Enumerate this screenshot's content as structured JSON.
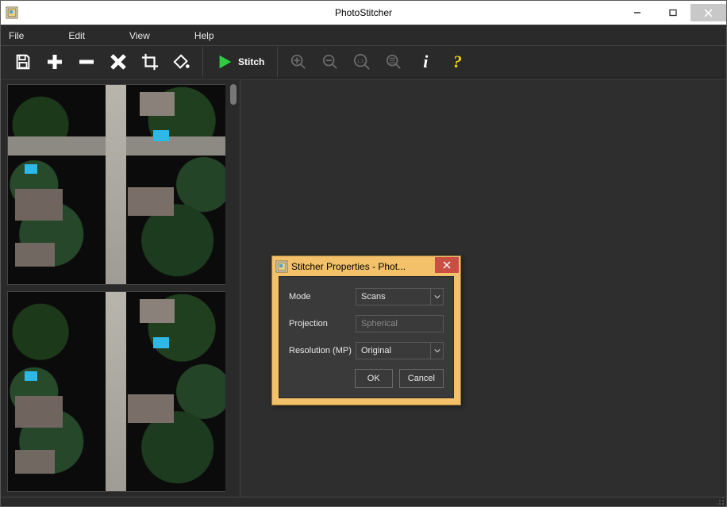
{
  "app": {
    "title": "PhotoStitcher"
  },
  "menu": {
    "file": "File",
    "edit": "Edit",
    "view": "View",
    "help": "Help"
  },
  "toolbar": {
    "stitch_label": "Stitch"
  },
  "dialog": {
    "title": "Stitcher Properties - Phot...",
    "labels": {
      "mode": "Mode",
      "projection": "Projection",
      "resolution": "Resolution (MP)"
    },
    "values": {
      "mode": "Scans",
      "projection": "Spherical",
      "resolution": "Original"
    },
    "buttons": {
      "ok": "OK",
      "cancel": "Cancel"
    }
  }
}
